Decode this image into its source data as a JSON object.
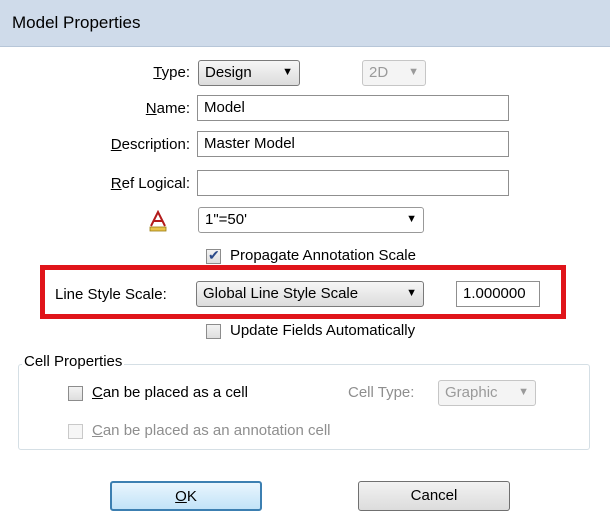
{
  "window": {
    "title": "Model Properties"
  },
  "type": {
    "label_underline": "T",
    "label_rest": "ype:",
    "value": "Design",
    "dimension": "2D"
  },
  "name": {
    "label_underline": "N",
    "label_rest": "ame:",
    "value": "Model"
  },
  "description": {
    "label_underline": "D",
    "label_rest": "escription:",
    "value": "Master Model"
  },
  "ref_logical": {
    "label_underline": "R",
    "label_rest": "ef Logical:",
    "value": ""
  },
  "annotation_scale": {
    "icon": "annotation-scale-icon",
    "value": "1\"=50'"
  },
  "propagate": {
    "label": "Propagate Annotation Scale",
    "checked": true
  },
  "line_style_scale": {
    "label": "Line Style Scale:",
    "value": "Global Line Style Scale",
    "number": "1.000000"
  },
  "update_fields": {
    "label": "Update Fields Automatically",
    "checked": false
  },
  "cell_properties": {
    "title": "Cell Properties",
    "can_place_cell_underline": "C",
    "can_place_cell_rest": "an be placed as a cell",
    "cell_type_label": "Cell Type:",
    "cell_type_value": "Graphic",
    "can_place_annot_underline": "C",
    "can_place_annot_rest": "an be placed as an annotation cell"
  },
  "buttons": {
    "ok_underline": "O",
    "ok_rest": "K",
    "cancel": "Cancel"
  },
  "colors": {
    "highlight": "#e0141a",
    "titlebar": "#cfdbea"
  }
}
